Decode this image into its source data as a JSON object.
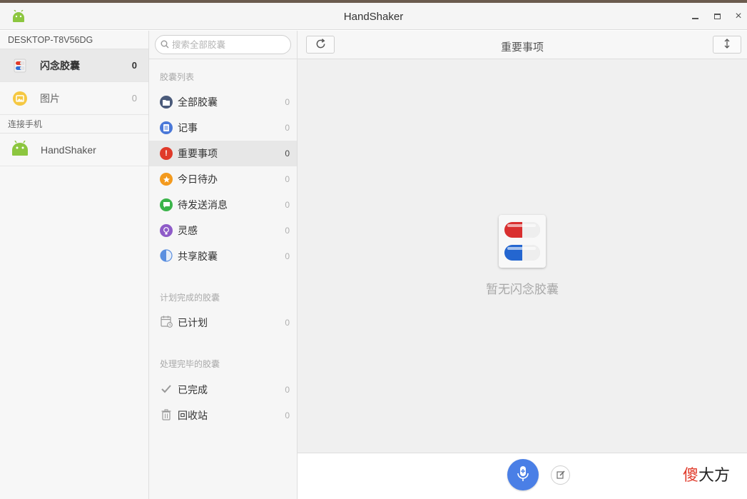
{
  "window": {
    "title": "HandShaker",
    "minimize_icon": "minimize-icon",
    "maximize_icon": "maximize-icon",
    "close_icon": "close-icon",
    "close_glyph": "×"
  },
  "sidebar": {
    "device_name": "DESKTOP-T8V56DG",
    "items": [
      {
        "label": "闪念胶囊",
        "count": "0",
        "icon": "capsule-icon",
        "active": true
      },
      {
        "label": "图片",
        "count": "0",
        "icon": "picture-icon",
        "active": false
      }
    ],
    "phone_section": "连接手机",
    "phone": {
      "label": "HandShaker",
      "icon": "android-icon"
    }
  },
  "capsules": {
    "search_placeholder": "搜索全部胶囊",
    "list_title": "胶囊列表",
    "items": [
      {
        "label": "全部胶囊",
        "count": "0",
        "icon": "folder-icon",
        "color": "#4a5a7a"
      },
      {
        "label": "记事",
        "count": "0",
        "icon": "note-icon",
        "color": "#4a78d8"
      },
      {
        "label": "重要事项",
        "count": "0",
        "icon": "exclamation-icon",
        "color": "#e03a2a",
        "active": true
      },
      {
        "label": "今日待办",
        "count": "0",
        "icon": "star-icon",
        "color": "#f39a1e"
      },
      {
        "label": "待发送消息",
        "count": "0",
        "icon": "message-icon",
        "color": "#3bb44a"
      },
      {
        "label": "灵感",
        "count": "0",
        "icon": "bulb-icon",
        "color": "#8e5bc8"
      },
      {
        "label": "共享胶囊",
        "count": "0",
        "icon": "share-icon",
        "color": "#5b8fe0"
      }
    ],
    "planned_title": "计划完成的胶囊",
    "planned": [
      {
        "label": "已计划",
        "count": "0",
        "icon": "calendar-icon"
      }
    ],
    "done_title": "处理完毕的胶囊",
    "done": [
      {
        "label": "已完成",
        "count": "0",
        "icon": "check-icon"
      },
      {
        "label": "回收站",
        "count": "0",
        "icon": "trash-icon"
      }
    ]
  },
  "main": {
    "title": "重要事项",
    "empty_text": "暂无闪念胶囊",
    "refresh_icon": "refresh-icon",
    "sort_icon": "sort-icon",
    "mic_icon": "microphone-icon",
    "edit_icon": "edit-icon",
    "watermark_1": "傻",
    "watermark_2": "大方"
  }
}
